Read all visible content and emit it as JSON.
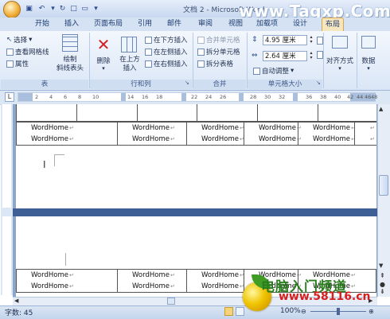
{
  "window": {
    "title": "文档 2 - Microsoft Word",
    "watermark": "www.Tagxp.Com"
  },
  "tabs": [
    "开始",
    "插入",
    "页面布局",
    "引用",
    "邮件",
    "审阅",
    "视图",
    "加载项",
    "设计",
    "布局"
  ],
  "ribbon": {
    "table_group": {
      "label": "表",
      "select": "选择",
      "view_gridlines": "查看网格线",
      "properties": "属性",
      "draw_diagonal": "绘制\n斜线表头"
    },
    "rows_cols_group": {
      "label": "行和列",
      "delete": "删除",
      "insert_above": "在上方\n插入",
      "insert_below": "在下方插入",
      "insert_left": "在左侧插入",
      "insert_right": "在右侧插入"
    },
    "merge_group": {
      "label": "合并",
      "merge_cells": "合并单元格",
      "split_cells": "拆分单元格",
      "split_table": "拆分表格"
    },
    "cell_size_group": {
      "label": "单元格大小",
      "height_value": "4.95 厘米",
      "width_value": "2.64 厘米",
      "autofit": "自动调整"
    },
    "alignment": "对齐方式",
    "data": "数据"
  },
  "ruler_ticks": [
    "2",
    "4",
    "6",
    "8",
    "10",
    "14",
    "16",
    "18",
    "22",
    "24",
    "26",
    "28",
    "30",
    "32",
    "36",
    "38",
    "40",
    "42",
    "44",
    "46",
    "48"
  ],
  "ruler_box": "L",
  "table_top": {
    "rows": [
      [
        "WordHome",
        "WordHome",
        "WordHome",
        "WordHome",
        "WordHome",
        ""
      ],
      [
        "WordHome",
        "WordHome",
        "WordHome",
        "WordHome",
        "WordHome",
        ""
      ]
    ]
  },
  "table_bottom": {
    "rows": [
      [
        "WordHome",
        "WordHome",
        "WordHome",
        "WordHome",
        "WordHome"
      ],
      [
        "WordHome",
        "WordHome",
        "WordHome",
        "WordHome",
        "WordHome"
      ]
    ]
  },
  "para_mark": "↵",
  "status": {
    "word_count": "字数: 45",
    "zoom": "100%"
  },
  "site_logo": {
    "text_cn": "电脑入门频道",
    "url": "www.58116.cn"
  }
}
